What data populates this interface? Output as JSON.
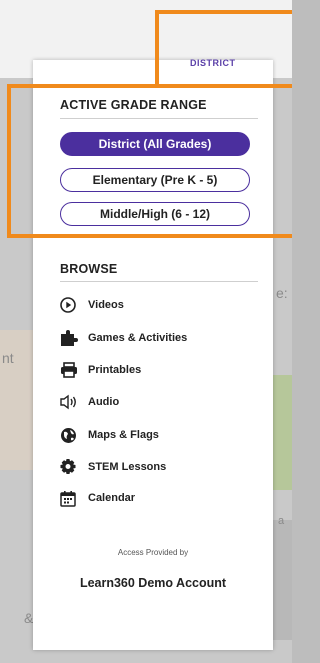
{
  "header": {
    "district_fragment": "DISTRICT"
  },
  "grade_range": {
    "title": "ACTIVE GRADE RANGE",
    "options": [
      {
        "label": "District (All Grades)",
        "active": true
      },
      {
        "label": "Elementary (Pre K - 5)",
        "active": false
      },
      {
        "label": "Middle/High (6 - 12)",
        "active": false
      }
    ]
  },
  "browse": {
    "title": "BROWSE",
    "items": [
      {
        "label": "Videos",
        "icon": "play-circle-icon"
      },
      {
        "label": "Games & Activities",
        "icon": "puzzle-icon"
      },
      {
        "label": "Printables",
        "icon": "printer-icon"
      },
      {
        "label": "Audio",
        "icon": "speaker-icon"
      },
      {
        "label": "Maps & Flags",
        "icon": "globe-icon"
      },
      {
        "label": "STEM Lessons",
        "icon": "gear-icon"
      },
      {
        "label": "Calendar",
        "icon": "calendar-icon"
      }
    ]
  },
  "footer": {
    "access_label": "Access Provided by",
    "account_name": "Learn360 Demo Account"
  },
  "background_fragments": {
    "left": "nt",
    "right": "e:",
    "right2": "a",
    "bottom": "&"
  },
  "colors": {
    "accent": "#4b2f9e",
    "callout": "#f08a1c"
  }
}
